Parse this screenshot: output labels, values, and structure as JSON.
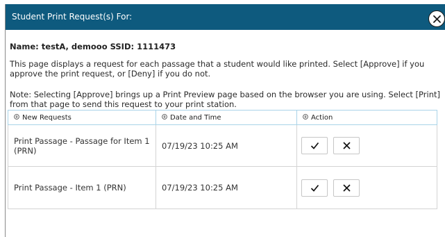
{
  "dialog": {
    "title": "Student Print Request(s) For:",
    "student_line": "Name: testA, demooo SSID: 1111473",
    "description": "This page displays a request for each passage that a student would like printed. Select [Approve] if you approve the print request, or [Deny] if you do not.",
    "note": "Note: Selecting [Approve] brings up a Print Preview page based on the browser you are using. Select [Print] from that page to send this request to your print station."
  },
  "table": {
    "columns": [
      "New Requests",
      "Date and Time",
      "Action"
    ],
    "rows": [
      {
        "request": "Print Passage - Passage for Item 1 (PRN)",
        "datetime": "07/19/23 10:25 AM"
      },
      {
        "request": "Print Passage - Item 1 (PRN)",
        "datetime": "07/19/23 10:25 AM"
      }
    ]
  },
  "icons": {
    "close": "close-icon",
    "sort": "sort-icon",
    "approve": "checkmark-icon",
    "deny": "x-icon"
  },
  "colors": {
    "header_bg": "#0e5a7e",
    "header_text": "#ffffff",
    "table_header_border": "#a9d3e8"
  }
}
